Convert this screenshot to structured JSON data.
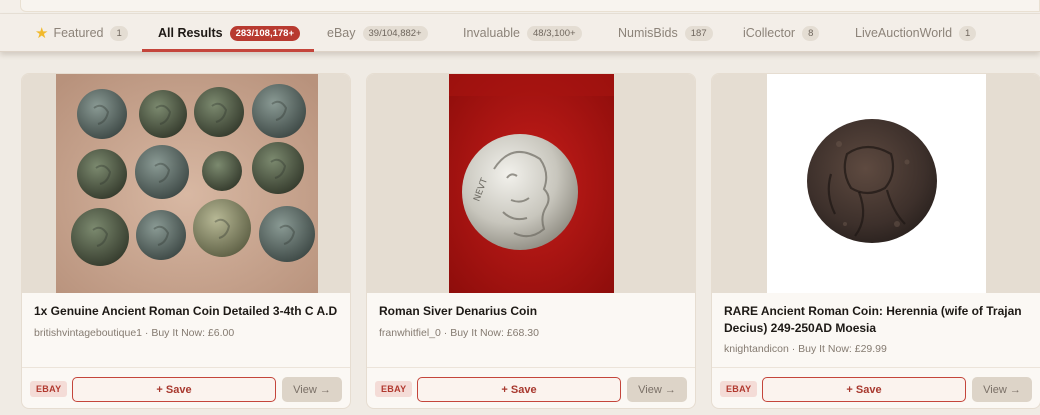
{
  "tabs": [
    {
      "label": "Featured",
      "count": "1",
      "icon": "star-icon"
    },
    {
      "label": "All Results",
      "count": "283/108,178+",
      "active": true
    },
    {
      "label": "eBay",
      "count": "39/104,882+"
    },
    {
      "label": "Invaluable",
      "count": "48/3,100+"
    },
    {
      "label": "NumisBids",
      "count": "187"
    },
    {
      "label": "iCollector",
      "count": "8"
    },
    {
      "label": "LiveAuctionWorld",
      "count": "1"
    }
  ],
  "cards": [
    {
      "title": "1x Genuine Ancient Roman Coin Detailed 3-4th C A.D",
      "meta": "britishvintageboutique1 · Buy It Now: £6.00",
      "source": "EBAY",
      "save_label": "+ Save",
      "view_label": "View →"
    },
    {
      "title": "Roman Siver Denarius Coin",
      "meta": "franwhitfiel_0 · Buy It Now: £68.30",
      "source": "EBAY",
      "save_label": "+ Save",
      "view_label": "View →"
    },
    {
      "title": "RARE Ancient Roman Coin: Herennia (wife of Trajan Decius) 249-250AD Moesia",
      "meta": "knightandicon · Buy It Now: £29.99",
      "source": "EBAY",
      "save_label": "+ Save",
      "view_label": "View →"
    }
  ],
  "colors": {
    "accent": "#c4453b",
    "page_bg": "#f0ebe4"
  }
}
